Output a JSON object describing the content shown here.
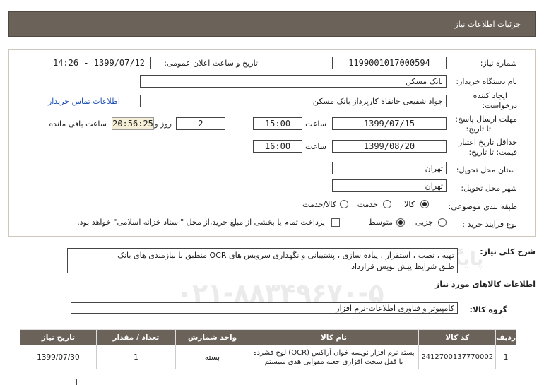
{
  "header": {
    "title": "جزئیات اطلاعات نیاز"
  },
  "form": {
    "need_number_label": "شماره نیاز:",
    "need_number": "1199001017000594",
    "announce_label": "تاریخ و ساعت اعلان عمومی:",
    "announce_value": "1399/07/12 - 14:26",
    "buyer_label": "نام دستگاه خریدار:",
    "buyer_value": "بانک مسکن",
    "creator_label_1": "ایجاد کننده",
    "creator_label_2": "درخواست:",
    "creator_value": "جواد شفیعی خانقاه کارپرداز بانک مسکن",
    "contact_link": "اطلاعات تماس خریدار",
    "send_deadline_label_1": "مهلت ارسال پاسخ:",
    "send_deadline_label_2": "تا تاریخ:",
    "send_date": "1399/07/15",
    "time_label": "ساعت",
    "send_time": "15:00",
    "days_value": "2",
    "days_label": "روز و",
    "remaining_time": "20:56:25",
    "remaining_label": "ساعت باقی مانده",
    "validity_label_1": "حداقل تاریخ اعتبار",
    "validity_label_2": "قیمت: تا تاریخ:",
    "validity_date": "1399/08/20",
    "validity_time": "16:00",
    "province_label": "استان محل تحویل:",
    "province_value": "تهران",
    "city_label": "شهر محل تحویل:",
    "city_value": "تهران",
    "category_label": "طبقه بندی موضوعی:",
    "category_options": [
      "کالا",
      "خدمت",
      "کالا/خدمت"
    ],
    "process_label": "نوع فرآیند خرید :",
    "process_options": [
      "جزیی",
      "متوسط"
    ],
    "payment_note": "پرداخت تمام یا بخشی از مبلغ خرید،از محل \"اسناد خزانه اسلامی\" خواهد بود."
  },
  "description": {
    "label": "شرح کلی نیاز:",
    "line1": "تهیه ، نصب ، استقرار ، پیاده سازی ، پشتیبانی و نگهداری سرویس های OCR منطبق با نیازمندی های بانک",
    "line2": "طبق شرایط پیش نویس قرارداد"
  },
  "goods": {
    "section_title": "اطلاعات کالاهای مورد نیاز",
    "group_label": "گروه کالا:",
    "group_value": "کامپیوتر و فناوری اطلاعات-نرم افزار",
    "columns": [
      "ردیف",
      "کد کالا",
      "نام کالا",
      "واحد شمارش",
      "تعداد / مقدار",
      "تاریخ نیاز"
    ],
    "rows": [
      {
        "row": "1",
        "code": "2412700137770002",
        "name": "بسته نرم افزار نویسه خوان آراکس (OCR) لوح فشرده با قفل سخت افزاری جعبه مقوایی هدی سیستم",
        "unit": "بسته",
        "qty": "1",
        "date": "1399/07/30"
      }
    ]
  },
  "watermark": {
    "number": "10101",
    "brand": "ParsNamadData",
    "slogan": "پایگاه اطلاع رسانی مناقصه و مزایده",
    "phone": "۰۲۱-۸۸۳۴۹۶۷۰-۵"
  }
}
